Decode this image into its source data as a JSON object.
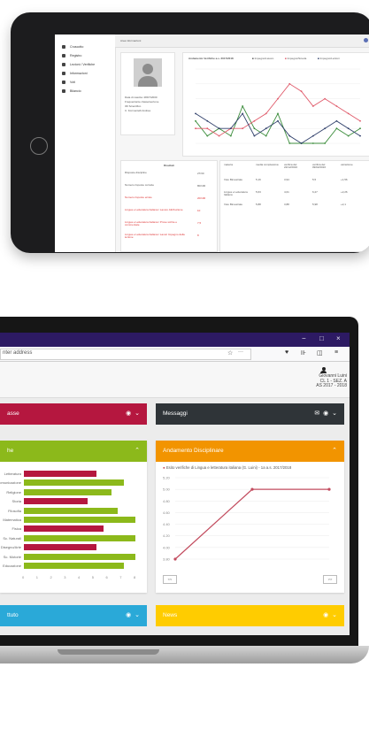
{
  "tablet": {
    "top_label": "Area informazioni",
    "sidebar": [
      "Cruscotto",
      "Registro",
      "Lezioni / Verifiche",
      "Informazioni",
      "Voti",
      "Bilancio"
    ],
    "profile_lines": [
      "Data di nascita: 28/07/2000",
      "Frequentante classe/sezione",
      "3D Scientifico",
      "C. Formentelli Andrea"
    ],
    "chart_title": "Andamento Verifiche a.s. 2017/2018",
    "chart_legend": [
      "Impegno/Lavoro",
      "Impegno/Scuola",
      "Impegno/Lezioni"
    ],
    "table_left_header": "Risultati",
    "table_left_rows": [
      {
        "label": "Risposte discipline",
        "value": "27/30",
        "red": false
      },
      {
        "label": "Numero risposte corrette",
        "value": "80/100",
        "red": false
      },
      {
        "label": "Numero risposte errate",
        "value": "20/100",
        "red": true
      },
      {
        "label": "Lingua e Letteratura Italiana / Lavoro Attribuzione",
        "value": "10",
        "red": true
      },
      {
        "label": "Lingua e Letteratura Italiana / Prove scritte e commentate",
        "value": "7,5",
        "red": true
      },
      {
        "label": "Lingua e Letteratura Italiana / Lavori Impegno della lezione",
        "value": "8",
        "red": true
      }
    ],
    "table_right_headers": [
      "materia",
      "media complessiva",
      "verifica del 22/12/2016",
      "verifica del 09/02/2016",
      "variazione"
    ],
    "table_right_rows": [
      [
        "Voto Bimestrale",
        "5,16",
        "3,94",
        "5,5",
        "+1,56"
      ],
      [
        "Lingua e Letteratura Italiana",
        "5,63",
        "4,01",
        "6,27",
        "+2,26"
      ],
      [
        "Voto Bimestrale",
        "5,88",
        "3,88",
        "5,98",
        "+2,1"
      ]
    ]
  },
  "laptop": {
    "window_controls": [
      "−",
      "□",
      "×"
    ],
    "address_placeholder": "nter address",
    "toolbar_icons": [
      "☆",
      "···",
      "♥",
      "⊪",
      "◫",
      "≡"
    ],
    "user": {
      "name": "Giovanni Luini",
      "class": "CL 1 - SEZ. A",
      "year": "AS 2017 - 2018"
    },
    "panels": {
      "classe": {
        "title": "asse",
        "color": "#b5173f"
      },
      "messaggi": {
        "title": "Messaggi",
        "color": "#2f3438"
      },
      "materie": {
        "title": "he",
        "color": "#8cb91b"
      },
      "disciplinare": {
        "title": "Andamento Disciplinare",
        "color": "#f29400"
      },
      "studio": {
        "title": "ttuto",
        "color": "#2aa9d8"
      },
      "news": {
        "title": "News",
        "color": "#ffcc00"
      }
    },
    "bar_labels": [
      "Letteratura",
      "Comunicazione",
      "Religione",
      "Storia",
      "Filosofia",
      "Matematica",
      "Fisica",
      "Sc. Naturali",
      "Disegno/Arte",
      "Sc. Motorie",
      "Educazione"
    ],
    "bar_axis_ticks": [
      "0",
      "1",
      "2",
      "3",
      "4",
      "5",
      "6",
      "7",
      "8"
    ],
    "line_legend": "Esito verifiche di Lingua e letteratura italiana (G. Luini) - 1a a.s. 2017/2018",
    "line_yticks": [
      "5.20",
      "5.00",
      "4.80",
      "4.60",
      "4.40",
      "4.20",
      "4.00",
      "3.80"
    ],
    "line_buttons": [
      "<<",
      ">>"
    ]
  },
  "chart_data": [
    {
      "type": "bar",
      "title": "",
      "categories": [
        "Letteratura",
        "Comunicazione",
        "Religione",
        "Storia",
        "Filosofia",
        "Matematica",
        "Fisica",
        "Sc. Naturali",
        "Disegno/Arte",
        "Sc. Motorie",
        "Educazione"
      ],
      "values": [
        5.2,
        7.2,
        6.3,
        4.6,
        6.7,
        8.0,
        5.7,
        8.0,
        5.2,
        8.0,
        7.2
      ],
      "colors": [
        "#b5173f",
        "#8cb91b",
        "#8cb91b",
        "#b5173f",
        "#8cb91b",
        "#8cb91b",
        "#b5173f",
        "#8cb91b",
        "#b5173f",
        "#8cb91b",
        "#8cb91b"
      ],
      "xlim": [
        0,
        8
      ]
    },
    {
      "type": "line",
      "title": "",
      "x": [
        1,
        2,
        3
      ],
      "series": [
        {
          "name": "Esito verifiche di Lingua e letteratura italiana (G. Luini) - 1a a.s. 2017/2018",
          "values": [
            3.8,
            5.0,
            5.0
          ]
        }
      ],
      "ylim": [
        3.8,
        5.2
      ],
      "color": "#c24b5e"
    },
    {
      "type": "line",
      "title": "Andamento Verifiche a.s. 2017/2018",
      "x": [
        1,
        2,
        3,
        4,
        5,
        6,
        7,
        8,
        9,
        10,
        11,
        12,
        13,
        14,
        15
      ],
      "series": [
        {
          "name": "Impegno/Lavoro",
          "values": [
            3,
            1,
            2,
            1,
            5,
            2,
            1,
            4,
            0,
            0,
            0,
            0,
            2,
            1,
            2
          ]
        },
        {
          "name": "Impegno/Scuola",
          "values": [
            2,
            2,
            1,
            2,
            2,
            3,
            4,
            6,
            8,
            7,
            5,
            6,
            5,
            4,
            3
          ]
        },
        {
          "name": "Impegno/Lezioni",
          "values": [
            4,
            3,
            2,
            2,
            4,
            1,
            2,
            3,
            1,
            0,
            1,
            2,
            3,
            2,
            1
          ]
        }
      ],
      "ylim": [
        0,
        10
      ],
      "colors": [
        "#3c8d3c",
        "#e05a6a",
        "#2f3f6a"
      ]
    }
  ]
}
